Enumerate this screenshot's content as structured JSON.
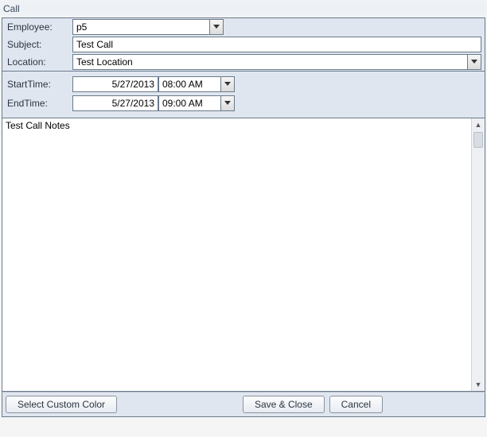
{
  "title": "Call",
  "labels": {
    "employee": "Employee:",
    "subject": "Subject:",
    "location": "Location:",
    "start": "StartTime:",
    "end": "EndTime:"
  },
  "fields": {
    "employee": "p5",
    "subject": "Test Call",
    "location": "Test Location",
    "start_date": "5/27/2013",
    "start_time": "08:00 AM",
    "end_date": "5/27/2013",
    "end_time": "09:00 AM",
    "notes": "Test Call Notes"
  },
  "buttons": {
    "custom_color": "Select Custom Color",
    "save_close": "Save & Close",
    "cancel": "Cancel"
  }
}
